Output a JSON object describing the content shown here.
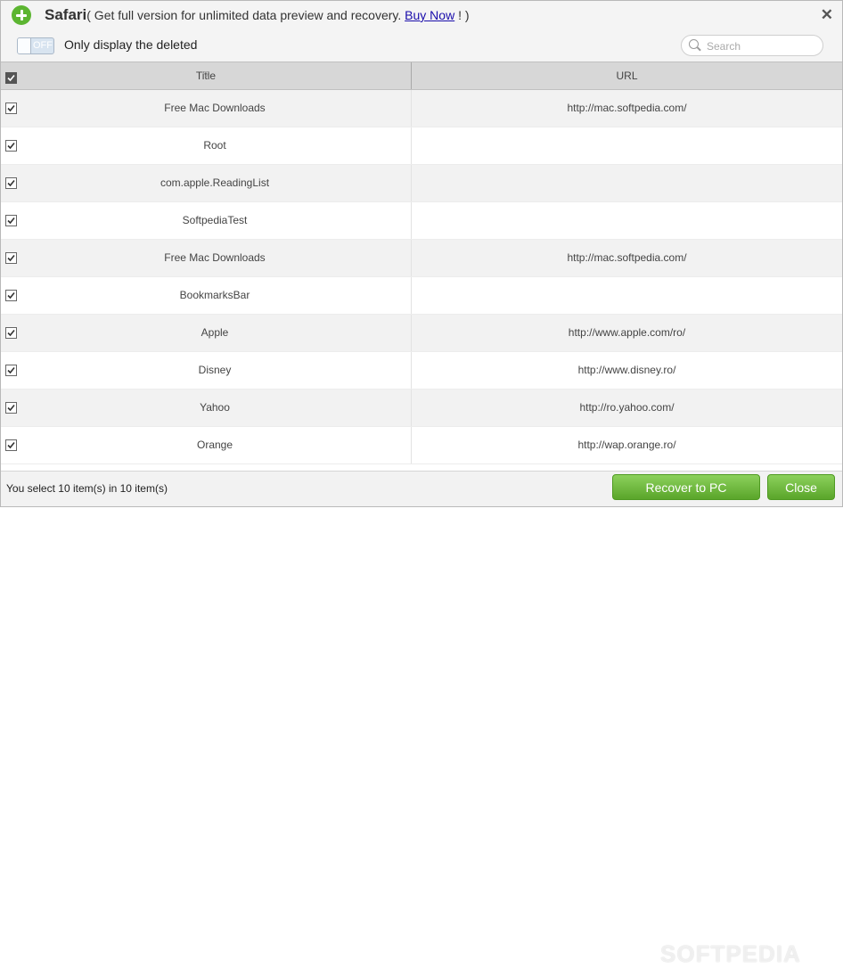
{
  "titlebar": {
    "app_name": "Safari",
    "message_prefix": "( Get full version for unlimited data preview and recovery. ",
    "buy_link": "Buy Now",
    "message_suffix": " ! )",
    "close_symbol": "✕"
  },
  "filter": {
    "toggle_state": "OFF",
    "label": "Only display the deleted",
    "search_placeholder": "Search"
  },
  "table": {
    "columns": {
      "title": "Title",
      "url": "URL"
    },
    "rows": [
      {
        "title": "Free Mac Downloads",
        "url": "http://mac.softpedia.com/",
        "checked": true
      },
      {
        "title": "Root",
        "url": "",
        "checked": true
      },
      {
        "title": "com.apple.ReadingList",
        "url": "",
        "checked": true
      },
      {
        "title": "SoftpediaTest",
        "url": "",
        "checked": true
      },
      {
        "title": "Free Mac Downloads",
        "url": "http://mac.softpedia.com/",
        "checked": true
      },
      {
        "title": "BookmarksBar",
        "url": "",
        "checked": true
      },
      {
        "title": "Apple",
        "url": "http://www.apple.com/ro/",
        "checked": true
      },
      {
        "title": "Disney",
        "url": "http://www.disney.ro/",
        "checked": true
      },
      {
        "title": "Yahoo",
        "url": "http://ro.yahoo.com/",
        "checked": true
      },
      {
        "title": "Orange",
        "url": "http://wap.orange.ro/",
        "checked": true
      }
    ]
  },
  "footer": {
    "status": "You select 10 item(s) in 10 item(s)",
    "recover_label": "Recover to PC",
    "close_label": "Close",
    "watermark": "SOFTPEDIA"
  },
  "colors": {
    "accent_green": "#5cb531",
    "header_bg": "#d7d7d7",
    "link_blue": "#1a0dab"
  }
}
